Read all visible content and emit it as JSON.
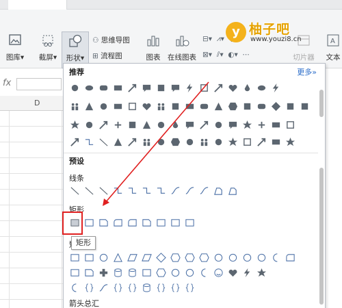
{
  "ribbon": {
    "picture_label": "图库",
    "screenshot_label": "截屏",
    "shapes_label": "形状",
    "mindmap_label": "思维导图",
    "flowchart_label": "流程图",
    "chart_label": "图表",
    "online_chart_label": "在线图表",
    "slicer_label": "切片器",
    "text_label": "文本"
  },
  "watermark": {
    "big": "柚子吧",
    "url": "www.youzi8.cn",
    "circle": "y"
  },
  "sheet": {
    "fx": "fx",
    "column": "D"
  },
  "panel": {
    "recommended": "推荐",
    "more": "更多»",
    "preset": "预设",
    "lines": "线条",
    "rectangles": "矩形",
    "basic_shapes": "矩形",
    "arrows": "箭头总汇",
    "tooltip": "矩形"
  },
  "colors": {
    "accent": "#2a6cc9",
    "annotation": "#e02020",
    "icon_gray": "#5c6670",
    "shape_blue": "#4a6fa5"
  }
}
